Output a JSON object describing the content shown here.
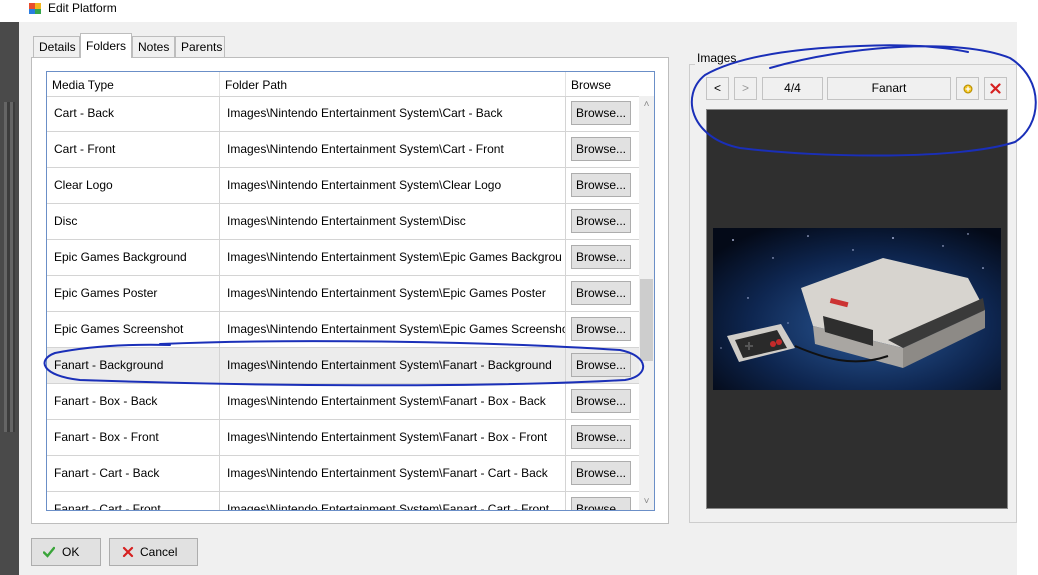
{
  "window": {
    "title": "Edit Platform"
  },
  "tabs": [
    {
      "label": "Details"
    },
    {
      "label": "Folders",
      "active": true
    },
    {
      "label": "Notes"
    },
    {
      "label": "Parents"
    }
  ],
  "grid": {
    "columns": [
      "Media Type",
      "Folder Path",
      "Browse"
    ],
    "browse_label": "Browse...",
    "selected_row": 7,
    "rows": [
      {
        "media_type": "Cart - Back",
        "folder_path": "Images\\Nintendo Entertainment System\\Cart - Back"
      },
      {
        "media_type": "Cart - Front",
        "folder_path": "Images\\Nintendo Entertainment System\\Cart - Front"
      },
      {
        "media_type": "Clear Logo",
        "folder_path": "Images\\Nintendo Entertainment System\\Clear Logo"
      },
      {
        "media_type": "Disc",
        "folder_path": "Images\\Nintendo Entertainment System\\Disc"
      },
      {
        "media_type": "Epic Games Background",
        "folder_path": "Images\\Nintendo Entertainment System\\Epic Games Backgrou"
      },
      {
        "media_type": "Epic Games Poster",
        "folder_path": "Images\\Nintendo Entertainment System\\Epic Games Poster"
      },
      {
        "media_type": "Epic Games Screenshot",
        "folder_path": "Images\\Nintendo Entertainment System\\Epic Games Screensho"
      },
      {
        "media_type": "Fanart - Background",
        "folder_path": "Images\\Nintendo Entertainment System\\Fanart - Background"
      },
      {
        "media_type": "Fanart - Box - Back",
        "folder_path": "Images\\Nintendo Entertainment System\\Fanart - Box - Back"
      },
      {
        "media_type": "Fanart - Box - Front",
        "folder_path": "Images\\Nintendo Entertainment System\\Fanart - Box - Front"
      },
      {
        "media_type": "Fanart - Cart - Back",
        "folder_path": "Images\\Nintendo Entertainment System\\Fanart - Cart - Back"
      },
      {
        "media_type": "Fanart - Cart - Front",
        "folder_path": "Images\\Nintendo Entertainment System\\Fanart - Cart - Front"
      }
    ]
  },
  "images": {
    "group_label": "Images",
    "prev_label": "<",
    "next_label": ">",
    "counter": "4/4",
    "image_type": "Fanart",
    "add_icon": "star-add-icon",
    "delete_icon": "red-x-icon"
  },
  "buttons": {
    "ok_label": "OK",
    "cancel_label": "Cancel"
  },
  "colors": {
    "selection": "#ececec",
    "grid_border": "#6b8fc7",
    "annotation_ink": "#1a2fb8",
    "ok_icon": "#3aa53a",
    "cancel_icon": "#d62020"
  }
}
